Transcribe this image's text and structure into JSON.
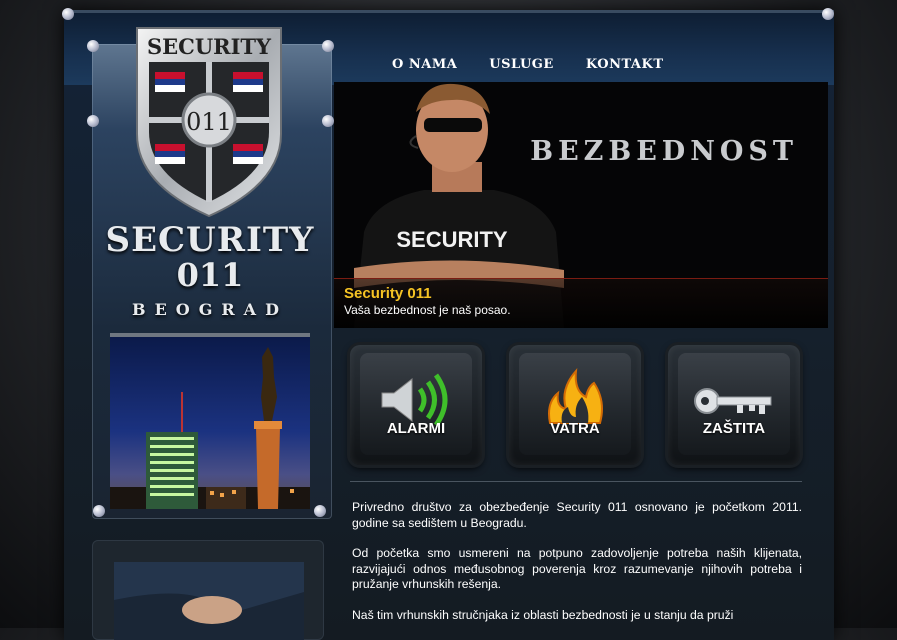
{
  "brand": {
    "shield_top": "SECURITY",
    "shield_number": "011",
    "line1": "SECURITY",
    "line2": "011",
    "line3": "BEOGRAD"
  },
  "nav": {
    "items": [
      "O NAMA",
      "USLUGE",
      "KONTAKT"
    ]
  },
  "hero": {
    "shirt_text": "SECURITY",
    "headline": "BEZBEDNOST",
    "caption_title": "Security 011",
    "caption_text": "Vaša bezbednost je naš posao."
  },
  "services": [
    {
      "label": "ALARMI",
      "icon": "speaker-alarm-icon"
    },
    {
      "label": "VATRA",
      "icon": "fire-icon"
    },
    {
      "label": "ZAŠTITA",
      "icon": "key-icon"
    }
  ],
  "content": {
    "paragraphs": [
      "Privredno društvo za obezbeđenje Security 011 osnovano je početkom 2011. godine sa sedištem u Beogradu.",
      "Od početka smo usmereni na potpuno zadovoljenje potreba naših klijenata, razvijajući odnos međusobnog poverenja kroz razumevanje njihovih potreba i pružanje vrhunskih rešenja.",
      "Naš tim vrhunskih stručnjaka iz oblasti bezbednosti je u stanju da pruži"
    ]
  },
  "colors": {
    "caption_title": "#f5c324",
    "accent_border": "#7a1c12",
    "fire": "#f7b112",
    "alarm_green": "#3fbf2a"
  }
}
